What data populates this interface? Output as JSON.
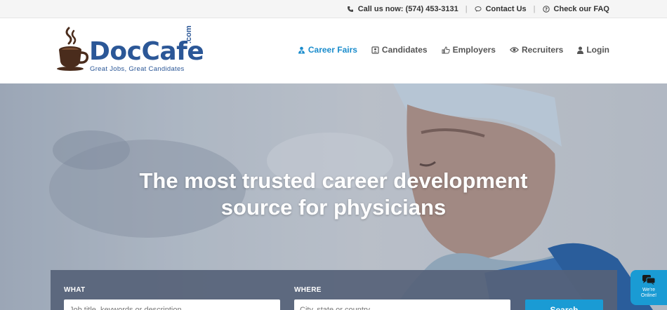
{
  "topbar": {
    "call_label": "Call us now: (574) 453-3131",
    "contact_label": "Contact Us",
    "faq_label": "Check our FAQ",
    "separator": "|"
  },
  "logo": {
    "word": "DocCafe",
    "com": ".com",
    "tagline": "Great Jobs, Great Candidates"
  },
  "nav": {
    "items": [
      {
        "label": "Career Fairs",
        "icon": "person-badge-icon"
      },
      {
        "label": "Candidates",
        "icon": "id-card-icon"
      },
      {
        "label": "Employers",
        "icon": "thumbs-up-icon"
      },
      {
        "label": "Recruiters",
        "icon": "eye-icon"
      },
      {
        "label": "Login",
        "icon": "user-icon"
      }
    ]
  },
  "hero": {
    "line1": "The most trusted career development",
    "line2": "source for physicians"
  },
  "search": {
    "what_label": "WHAT",
    "what_placeholder": "Job title, keywords or description",
    "where_label": "WHERE",
    "where_placeholder": "City, state or country",
    "button_label": "Search"
  },
  "chat": {
    "line1": "We're",
    "line2": "Online!"
  },
  "colors": {
    "brand_blue": "#2b5797",
    "accent_blue": "#1a8ccc",
    "search_button": "#1a9bd4",
    "coffee_brown": "#4a2c1c"
  }
}
